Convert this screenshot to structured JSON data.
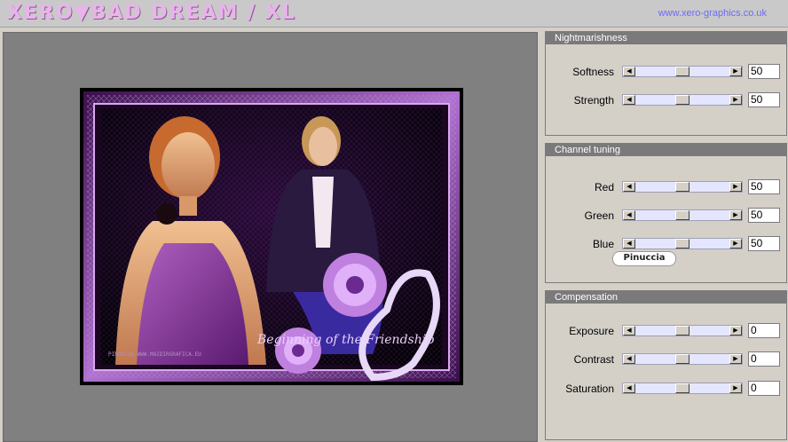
{
  "header": {
    "title": "XERO▼BAD DREAM / XL",
    "url": "www.xero-graphics.co.uk"
  },
  "preview": {
    "signature_text": "Beginning of the Friendship",
    "watermark": "PINUCCIA-WWW.MAIDIRGRAFICA.EU"
  },
  "panels": [
    {
      "title": "Nightmarishness",
      "rows": [
        {
          "label": "Softness",
          "value": "50",
          "level": 0.5
        },
        {
          "label": "Strength",
          "value": "50",
          "level": 0.5
        }
      ]
    },
    {
      "title": "Channel tuning",
      "rows": [
        {
          "label": "Red",
          "value": "50",
          "level": 0.5
        },
        {
          "label": "Green",
          "value": "50",
          "level": 0.5
        },
        {
          "label": "Blue",
          "value": "50",
          "level": 0.5
        }
      ],
      "badge": "Pinuccia"
    },
    {
      "title": "Compensation",
      "rows": [
        {
          "label": "Exposure",
          "value": "0",
          "level": 0.5
        },
        {
          "label": "Contrast",
          "value": "0",
          "level": 0.5
        },
        {
          "label": "Saturation",
          "value": "0",
          "level": 0.5
        }
      ]
    }
  ],
  "colors": {
    "accent_title": "#e8b4ea",
    "url_link": "#6a6aff",
    "slider_track": "#e4e6ff",
    "panel_header": "#7a7a7a"
  }
}
